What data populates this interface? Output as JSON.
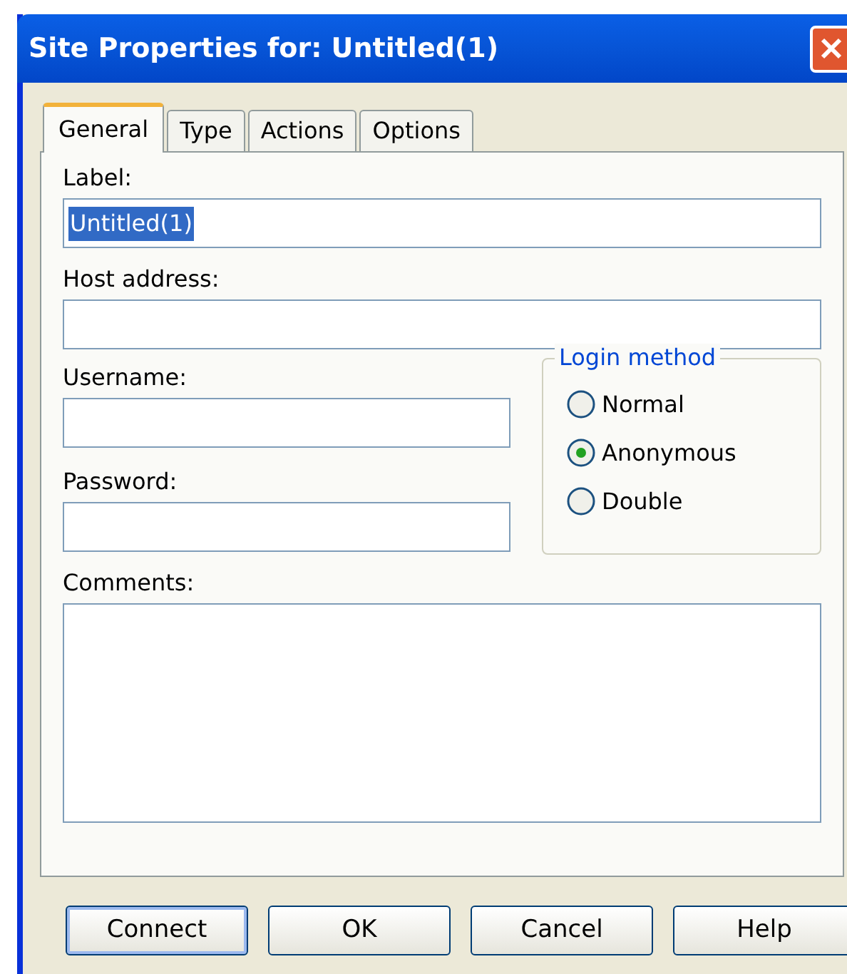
{
  "window": {
    "title": "Site Properties for: Untitled(1)"
  },
  "tabs": [
    {
      "label": "General",
      "selected": true
    },
    {
      "label": "Type",
      "selected": false
    },
    {
      "label": "Actions",
      "selected": false
    },
    {
      "label": "Options",
      "selected": false
    }
  ],
  "label_field": {
    "label": "Label:",
    "value": "Untitled(1)",
    "text_selected": true
  },
  "host_field": {
    "label": "Host address:"
  },
  "username_field": {
    "label": "Username:"
  },
  "password_field": {
    "label": "Password:"
  },
  "login_method": {
    "title": "Login method",
    "options": [
      {
        "label": "Normal",
        "selected": false
      },
      {
        "label": "Anonymous",
        "selected": true
      },
      {
        "label": "Double",
        "selected": false
      }
    ]
  },
  "comments_field": {
    "label": "Comments:"
  },
  "buttons": [
    {
      "label": "Connect",
      "default": true
    },
    {
      "label": "OK",
      "default": false
    },
    {
      "label": "Cancel",
      "default": false
    },
    {
      "label": "Help",
      "default": false
    }
  ]
}
